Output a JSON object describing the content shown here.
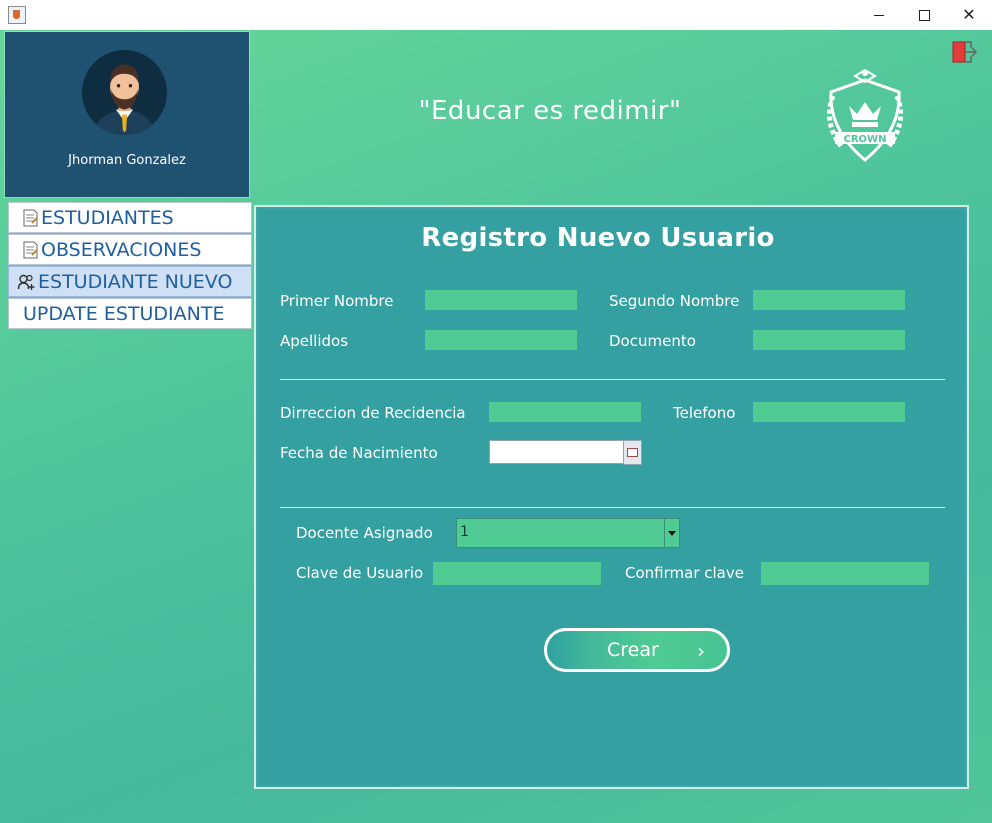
{
  "window": {
    "controls": {
      "minimize": "minimize",
      "maximize": "maximize",
      "close": "✕"
    }
  },
  "header": {
    "user_name": "Jhorman Gonzalez",
    "motto": "\"Educar es redimir\"",
    "crest_text": "CROWN"
  },
  "sidebar": {
    "items": [
      {
        "label": "ESTUDIANTES",
        "icon": "document-icon"
      },
      {
        "label": "OBSERVACIONES",
        "icon": "document-icon"
      },
      {
        "label": "ESTUDIANTE NUEVO",
        "icon": "add-user-icon",
        "active": true
      },
      {
        "label": "UPDATE ESTUDIANTE",
        "icon": null
      }
    ]
  },
  "form": {
    "title": "Registro Nuevo Usuario",
    "primer_nombre_label": "Primer Nombre",
    "segundo_nombre_label": "Segundo Nombre",
    "apellidos_label": "Apellidos",
    "documento_label": "Documento",
    "direccion_label": "Dirreccion de Recidencia",
    "telefono_label": "Telefono",
    "fecha_label": "Fecha de Nacimiento",
    "docente_label": "Docente Asignado",
    "docente_value": "1",
    "clave_label": "Clave de Usuario",
    "confirmar_label": "Confirmar clave",
    "submit_label": "Crear",
    "submit_chevron": "›"
  },
  "colors": {
    "background_green": "#5ccf9a",
    "profile_blue": "#1f5270",
    "panel_teal": "#34a0a2",
    "field_green": "#4fcb93",
    "exit_red": "#e23c3c"
  }
}
